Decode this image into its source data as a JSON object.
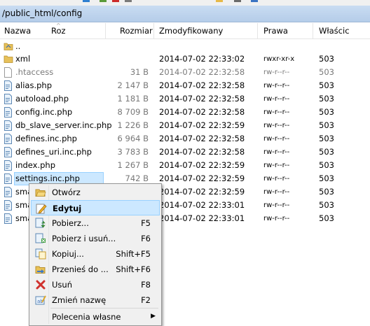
{
  "path": "/public_html/config",
  "columns": {
    "name": "Nazwa",
    "ext": "Roz",
    "size": "Rozmiar",
    "modified": "Zmodyfikowany",
    "perms": "Prawa",
    "owner": "Właścic"
  },
  "files": [
    {
      "name": "..",
      "size": "",
      "modified": "",
      "perms": "",
      "owner": "",
      "icon": "parent-folder-icon",
      "hidden": false
    },
    {
      "name": "xml",
      "size": "",
      "modified": "2014-07-02 22:33:02",
      "perms": "rwxr-xr-x",
      "owner": "503",
      "icon": "folder-icon",
      "hidden": false
    },
    {
      "name": ".htaccess",
      "size": "31 B",
      "modified": "2014-07-02 22:32:58",
      "perms": "rw-r--r--",
      "owner": "503",
      "icon": "file-icon",
      "hidden": true
    },
    {
      "name": "alias.php",
      "size": "2 147 B",
      "modified": "2014-07-02 22:32:58",
      "perms": "rw-r--r--",
      "owner": "503",
      "icon": "php-file-icon",
      "hidden": false
    },
    {
      "name": "autoload.php",
      "size": "1 181 B",
      "modified": "2014-07-02 22:32:58",
      "perms": "rw-r--r--",
      "owner": "503",
      "icon": "php-file-icon",
      "hidden": false
    },
    {
      "name": "config.inc.php",
      "size": "8 709 B",
      "modified": "2014-07-02 22:32:58",
      "perms": "rw-r--r--",
      "owner": "503",
      "icon": "php-file-icon",
      "hidden": false
    },
    {
      "name": "db_slave_server.inc.php",
      "size": "1 226 B",
      "modified": "2014-07-02 22:32:59",
      "perms": "rw-r--r--",
      "owner": "503",
      "icon": "php-file-icon",
      "hidden": false
    },
    {
      "name": "defines.inc.php",
      "size": "6 964 B",
      "modified": "2014-07-02 22:32:58",
      "perms": "rw-r--r--",
      "owner": "503",
      "icon": "php-file-icon",
      "hidden": false
    },
    {
      "name": "defines_uri.inc.php",
      "size": "3 783 B",
      "modified": "2014-07-02 22:32:58",
      "perms": "rw-r--r--",
      "owner": "503",
      "icon": "php-file-icon",
      "hidden": false
    },
    {
      "name": "index.php",
      "size": "1 267 B",
      "modified": "2014-07-02 22:32:59",
      "perms": "rw-r--r--",
      "owner": "503",
      "icon": "php-file-icon",
      "hidden": false
    },
    {
      "name": "settings.inc.php",
      "size": "742 B",
      "modified": "2014-07-02 22:32:59",
      "perms": "rw-r--r--",
      "owner": "503",
      "icon": "php-file-icon",
      "hidden": false,
      "selected": true
    },
    {
      "name": "sma",
      "size": "",
      "modified": "2014-07-02 22:32:59",
      "perms": "rw-r--r--",
      "owner": "503",
      "icon": "php-file-icon",
      "hidden": false
    },
    {
      "name": "sma",
      "size": "",
      "modified": "2014-07-02 22:33:01",
      "perms": "rw-r--r--",
      "owner": "503",
      "icon": "php-file-icon",
      "hidden": false
    },
    {
      "name": "sma",
      "size": "",
      "modified": "2014-07-02 22:33:01",
      "perms": "rw-r--r--",
      "owner": "503",
      "icon": "php-file-icon",
      "hidden": false
    }
  ],
  "context_menu": {
    "items": [
      {
        "label": "Otwórz",
        "shortcut": "",
        "icon": "open-folder-icon"
      },
      {
        "label": "Edytuj",
        "shortcut": "",
        "icon": "edit-pencil-icon",
        "highlighted": true,
        "bold": true
      },
      {
        "label": "Pobierz...",
        "shortcut": "F5",
        "icon": "download-icon"
      },
      {
        "label": "Pobierz i usuń...",
        "shortcut": "F6",
        "icon": "download-delete-icon"
      },
      {
        "label": "Kopiuj...",
        "shortcut": "Shift+F5",
        "icon": "copy-icon"
      },
      {
        "label": "Przenieś do ...",
        "shortcut": "Shift+F6",
        "icon": "move-icon"
      },
      {
        "label": "Usuń",
        "shortcut": "F8",
        "icon": "delete-x-icon"
      },
      {
        "label": "Zmień nazwę",
        "shortcut": "F2",
        "icon": "rename-icon"
      },
      {
        "label": "Polecenia własne",
        "shortcut": "",
        "icon": "",
        "submenu": true
      }
    ]
  }
}
